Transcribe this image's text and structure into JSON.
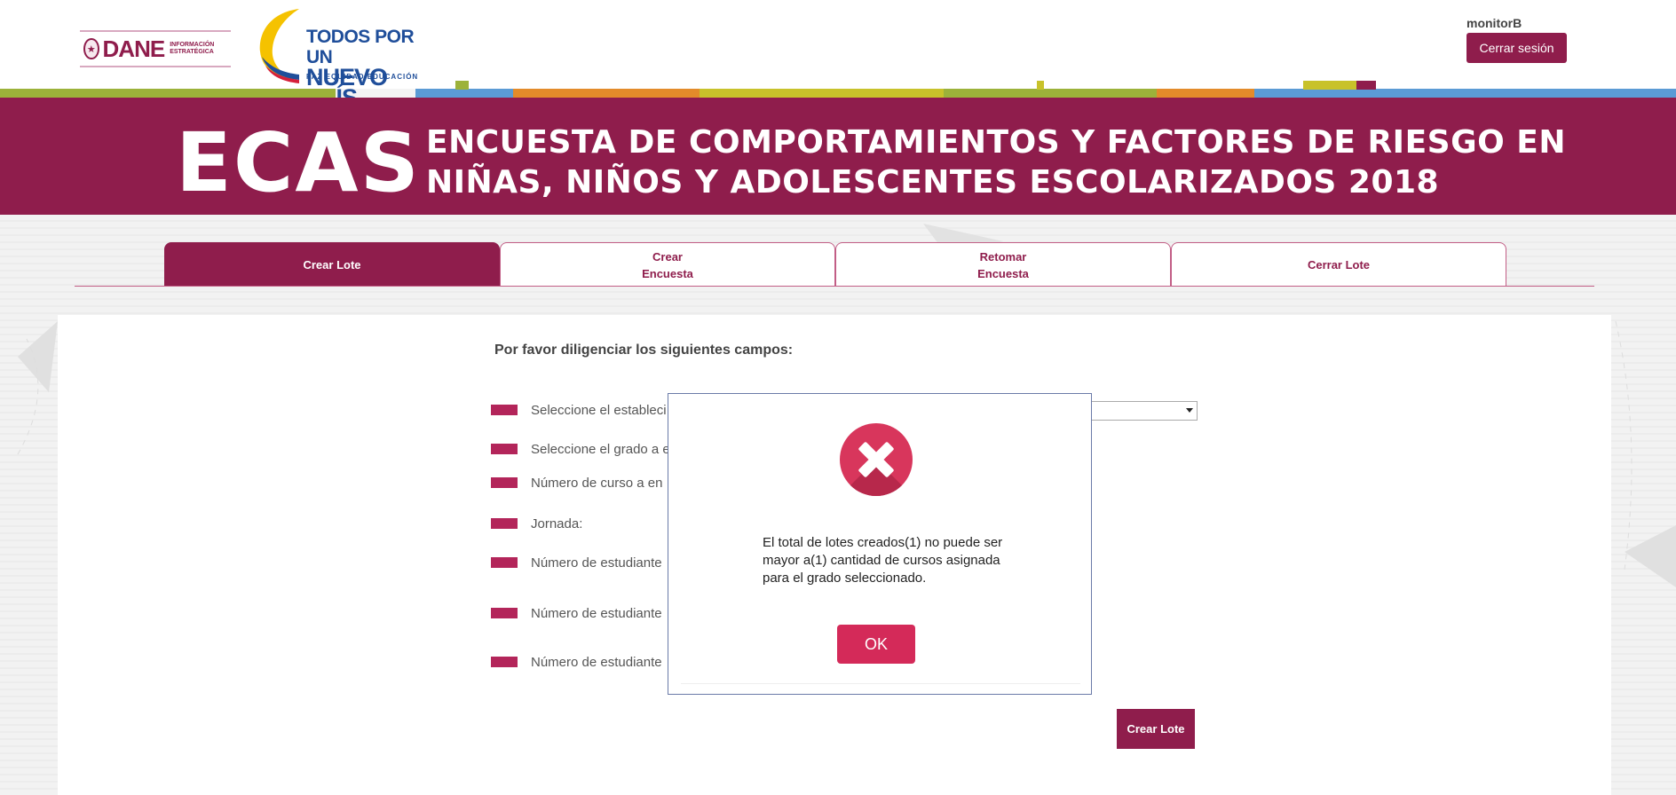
{
  "header": {
    "dane_logo_text": "DANE",
    "dane_logo_sub": "INFORMACIÓN ESTRATÉGICA",
    "gov_logo_line1": "TODOS POR UN",
    "gov_logo_line2": "NUEVO PAÍS",
    "gov_logo_tagline": "PAZ EQUIDAD EDUCACIÓN",
    "username": "monitorB",
    "logout_label": "Cerrar sesión"
  },
  "banner": {
    "acronym": "ECAS",
    "title_line1": "ENCUESTA DE COMPORTAMIENTOS Y FACTORES DE RIESGO EN",
    "title_line2": "NIÑAS, NIÑOS Y ADOLESCENTES ESCOLARIZADOS 2018"
  },
  "tabs": [
    {
      "label_line1": "Crear Lote",
      "label_line2": ""
    },
    {
      "label_line1": "Crear",
      "label_line2": "Encuesta"
    },
    {
      "label_line1": "Retomar",
      "label_line2": "Encuesta"
    },
    {
      "label_line1": "Cerrar Lote",
      "label_line2": ""
    }
  ],
  "form": {
    "intro": "Por favor diligenciar los siguientes campos:",
    "fields": [
      "Seleccione el estableci",
      "Seleccione el grado a e",
      "Número de curso a en",
      "Jornada:",
      "Número de estudiante",
      "Número de estudiante",
      "Número de estudiante"
    ],
    "create_button": "Crear Lote"
  },
  "modal": {
    "message": "El total de lotes creados(1) no puede ser mayor a(1) cantidad de cursos asignada para el grado seleccionado.",
    "ok_label": "OK"
  },
  "colors": {
    "brand": "#8f1d4c",
    "error": "#d8365c",
    "ok_button": "#d42a59"
  }
}
